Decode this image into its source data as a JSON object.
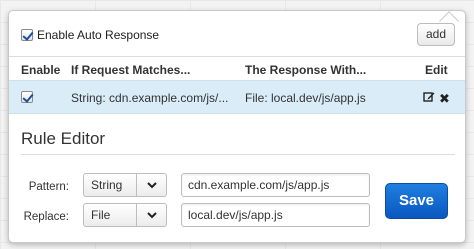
{
  "header": {
    "enable_auto_response_label": "Enable Auto Response",
    "enable_auto_response_checked": true,
    "add_label": "add"
  },
  "table": {
    "columns": [
      "Enable",
      "If Request Matches...",
      "The Response With...",
      "Edit"
    ],
    "rows": [
      {
        "enabled": true,
        "match": "String: cdn.example.com/js/...",
        "response": "File: local.dev/js/app.js",
        "edit_icon": "edit-icon",
        "delete_icon": "delete-icon"
      }
    ]
  },
  "rule_editor": {
    "title": "Rule Editor",
    "pattern_label": "Pattern:",
    "pattern_type": "String",
    "pattern_value": "cdn.example.com/js/app.js",
    "replace_label": "Replace:",
    "replace_type": "File",
    "replace_value": "local.dev/js/app.js",
    "save_label": "Save"
  },
  "colors": {
    "row_selected_bg": "#d9ecf8",
    "save_button": "#0a57c0"
  }
}
